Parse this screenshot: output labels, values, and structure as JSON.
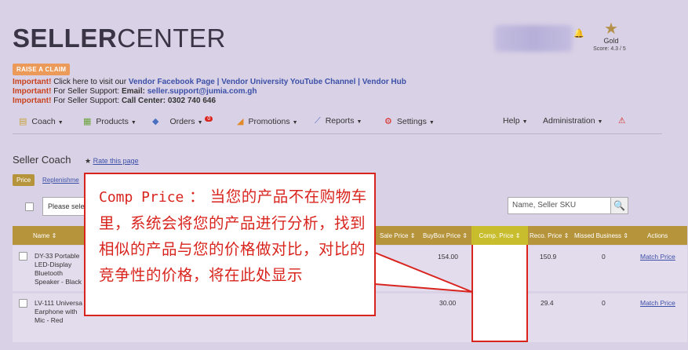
{
  "header": {
    "logo_bold": "SELLER",
    "logo_light": "CENTER",
    "badge_tier": "Gold",
    "badge_score": "Score: 4.3 / 5"
  },
  "claim_button": "RAISE A CLAIM",
  "notices": [
    {
      "label": "Important!",
      "text": " Click here to visit our ",
      "link1": "Vendor Facebook Page",
      "sep1": "  |  ",
      "link2": "Vendor University YouTube Channel",
      "sep2": "  |  ",
      "link3": "Vendor Hub"
    },
    {
      "label": "Important!",
      "text": " For Seller Support: ",
      "bold": "Email: ",
      "link": "seller.support@jumia.com.gh"
    },
    {
      "label": "Important!",
      "text": " For Seller Support: ",
      "bold": "Call Center: 0302 740 646"
    }
  ],
  "nav": {
    "coach": "Coach",
    "products": "Products",
    "orders": "Orders",
    "orders_badge": "0",
    "promotions": "Promotions",
    "reports": "Reports",
    "settings": "Settings",
    "help": "Help",
    "administration": "Administration"
  },
  "page": {
    "title": "Seller Coach",
    "rate_link": "Rate this page",
    "tab_price": "Price",
    "tab_replenishment": "Replenishme"
  },
  "filters": {
    "select_text": "Please sele",
    "search_placeholder": "Name, Seller SKU"
  },
  "table": {
    "headers": {
      "name": "Name",
      "sale_price": "Sale Price",
      "buybox_price": "BuyBox Price",
      "comp_price": "Comp. Price",
      "reco_price": "Reco. Price",
      "missed_business": "Missed Business",
      "actions": "Actions"
    },
    "rows": [
      {
        "name_lines": [
          "DY-33 Portable",
          "LED-Display",
          "Bluetooth",
          "Speaker - Black"
        ],
        "buybox": "154.00",
        "reco": "150.9",
        "missed": "0",
        "action": "Match Price"
      },
      {
        "name_lines": [
          "LV-111 Universa",
          "Earphone with",
          "Mic - Red"
        ],
        "buybox": "30.00",
        "reco": "29.4",
        "missed": "0",
        "action": "Match Price"
      }
    ]
  },
  "callout": {
    "term": "Comp Price",
    "colon": " ：  ",
    "text": "当您的产品不在购物车里，系统会将您的产品进行分析，找到相似的产品与您的价格做对比，对比的竞争性的价格，将在此处显示"
  },
  "colors": {
    "accent": "#b5943c",
    "highlight_col": "#c8bd2d",
    "annotation": "#d9241e",
    "link": "#3c50a8",
    "background": "#d9d2e6"
  }
}
